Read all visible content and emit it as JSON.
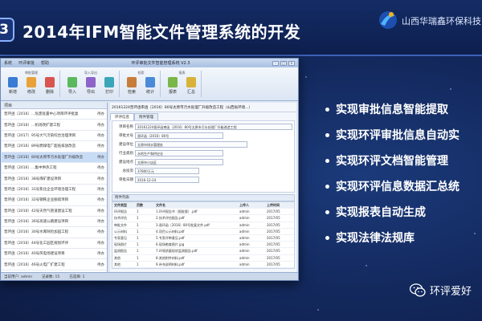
{
  "slide": {
    "number": "3",
    "title": "2014年IFM智能文件管理系统的开发",
    "company": "山西华瑞鑫环保科技"
  },
  "app": {
    "window_title": "环评审批文件智能管理系统 V2.3",
    "menu": [
      "系统",
      "环评审批",
      "帮助"
    ],
    "ribbon_groups": [
      {
        "label": "审批管理",
        "buttons": [
          "新增",
          "修改",
          "删除"
        ]
      },
      {
        "label": "导入导出",
        "buttons": [
          "导入",
          "导出",
          "打印"
        ]
      },
      {
        "label": "检索",
        "buttons": [
          "检索",
          "统计"
        ]
      },
      {
        "label": "报表",
        "buttons": [
          "报表",
          "汇总"
        ]
      }
    ],
    "left_title": "项目",
    "left_items": [
      {
        "name": "晋环函〔2016〕…危废处置中心项目环评批复",
        "status": "待办"
      },
      {
        "name": "晋环函〔2016〕…机场改扩建工程",
        "status": "待办"
      },
      {
        "name": "晋环函〔2017〕95号大气污染综合治理项目",
        "status": "待办"
      },
      {
        "name": "晋环函〔2016〕89号燃煤电厂超低排放改造",
        "status": "待办"
      },
      {
        "name": "晋环函〔2016〕80号太原市污水处理厂升级改造",
        "status": "待办"
      },
      {
        "name": "晋环函〔2016〕…集中供热工程",
        "status": "待办"
      },
      {
        "name": "晋环函〔2016〕38号煤矿建设项目",
        "status": "待办"
      },
      {
        "name": "晋环函〔2016〕31号焦化企业环境治理工程",
        "status": "待办"
      },
      {
        "name": "晋环函〔2016〕32号钢铁企业脱硫项目",
        "status": "待办"
      },
      {
        "name": "晋环函〔2016〕42号天然气管道建设工程",
        "status": "待办"
      },
      {
        "name": "晋环函〔2016〕36号高速公路建设项目",
        "status": "待办"
      },
      {
        "name": "晋环函〔2016〕30号水库除险加固工程",
        "status": "待办"
      },
      {
        "name": "晋环函〔2016〕44号化工园区规划环评",
        "status": "待办"
      },
      {
        "name": "晋环函〔2016〕40号风电场建设项目",
        "status": "待办"
      },
      {
        "name": "晋环函〔2016〕46号火电厂扩建工程",
        "status": "待办"
      }
    ],
    "detail_title": "20161224晋环函审函〔2016〕80号太原市污水处理厂升级改造工程（山西省环境…）",
    "tabs": [
      "环评信息",
      "附件管理"
    ],
    "form": [
      {
        "label": "项目名称",
        "value": "20161224晋环函审函〔2016〕80号太原市污水处理厂升级改造工程"
      },
      {
        "label": "审批文号",
        "value": "晋环函〔2016〕80号"
      },
      {
        "label": "建设单位",
        "value": "太原市排水管理处"
      },
      {
        "label": "行业类别",
        "value": "水的生产和供应业"
      },
      {
        "label": "建设地点",
        "value": "太原市小店区"
      },
      {
        "label": "总投资",
        "value": "37800万元"
      },
      {
        "label": "审批日期",
        "value": "2016-12-24"
      }
    ],
    "files_title": "附件列表",
    "file_headers": [
      "文件类型",
      "页数",
      "文件名",
      "上传人",
      "上传时间"
    ],
    "files": [
      {
        "type": "环评报告",
        "pages": "1",
        "name": "1.环评报告书（报批版）.pdf",
        "user": "admin",
        "date": "2017/05"
      },
      {
        "type": "技术评估",
        "pages": "1",
        "name": "2.技术评估报告.pdf",
        "user": "admin",
        "date": "2017/05"
      },
      {
        "type": "审批文件",
        "pages": "1",
        "name": "3.晋环函〔2016〕80号批复文件.pdf",
        "user": "admin",
        "date": "2017/05"
      },
      {
        "type": "公示材料",
        "pages": "1",
        "name": "4.项目公示材料.pdf",
        "user": "admin",
        "date": "2017/05"
      },
      {
        "type": "专家意见",
        "pages": "1",
        "name": "5.专家评审意见.pdf",
        "user": "admin",
        "date": "2017/05"
      },
      {
        "type": "现场照片",
        "pages": "1",
        "name": "6.现场勘查照片.jpg",
        "user": "admin",
        "date": "2017/05"
      },
      {
        "type": "监测报告",
        "pages": "1",
        "name": "7.环境质量现状监测报告.pdf",
        "user": "admin",
        "date": "2017/05"
      },
      {
        "type": "其他",
        "pages": "1",
        "name": "8.其他附件材料.pdf",
        "user": "admin",
        "date": "2017/05"
      },
      {
        "type": "其他",
        "pages": "1",
        "name": "9.补充说明材料.pdf",
        "user": "admin",
        "date": "2017/05"
      }
    ],
    "status": [
      "当前用户: admin",
      "记录数: 15",
      "已选择: 1"
    ]
  },
  "bullets": [
    "实现审批信息智能提取",
    "实现环评审批信息自动实",
    "实现环评文档智能管理",
    "实现环评信息数据汇总统",
    "实现报表自动生成",
    "实现法律法规库"
  ],
  "wechat": {
    "text": "环评爱好"
  },
  "colors": {
    "accent": "#3d62b8",
    "background": "#13295e"
  }
}
